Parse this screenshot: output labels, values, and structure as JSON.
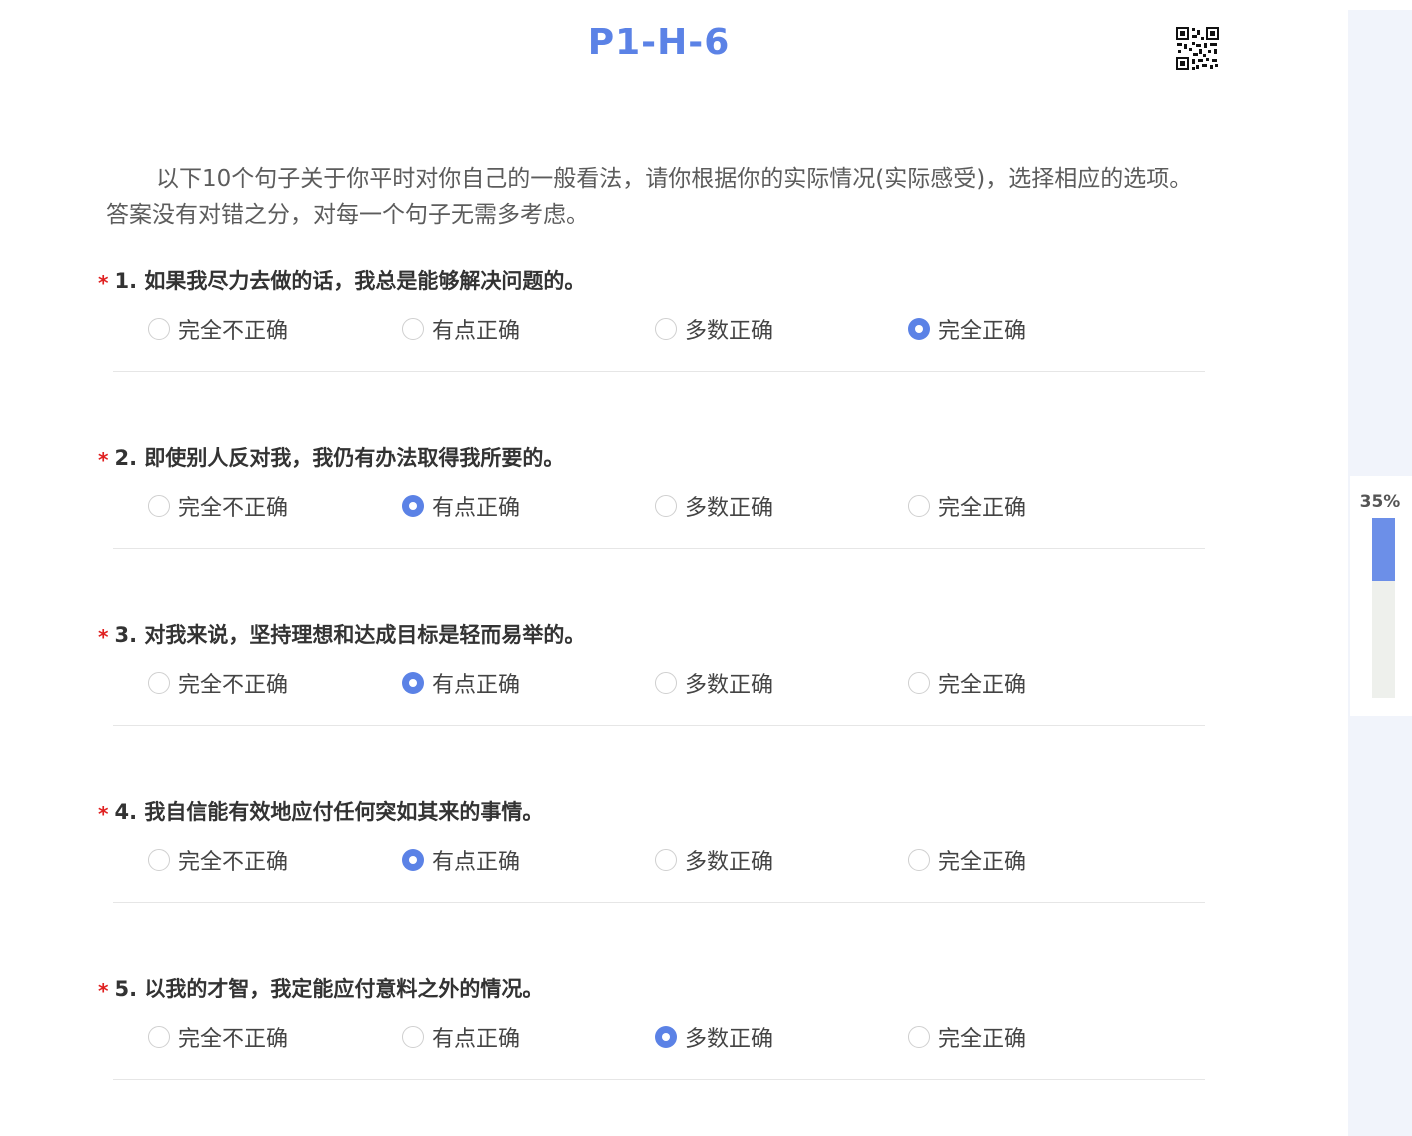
{
  "header": {
    "title": "P1-H-6",
    "qr_icon": "qr-code-icon"
  },
  "intro": "以下10个句子关于你平时对你自己的一般看法，请你根据你的实际情况(实际感受)，选择相应的选项。答案没有对错之分，对每一个句子无需多考虑。",
  "required_mark": "*",
  "options": [
    "完全不正确",
    "有点正确",
    "多数正确",
    "完全正确"
  ],
  "questions": [
    {
      "title": "1. 如果我尽力去做的话，我总是能够解决问题的。",
      "selected_index": 3
    },
    {
      "title": "2. 即使别人反对我，我仍有办法取得我所要的。",
      "selected_index": 1
    },
    {
      "title": "3. 对我来说，坚持理想和达成目标是轻而易举的。",
      "selected_index": 1
    },
    {
      "title": "4. 我自信能有效地应付任何突如其来的事情。",
      "selected_index": 1
    },
    {
      "title": "5. 以我的才智，我定能应付意料之外的情况。",
      "selected_index": 2
    }
  ],
  "progress": {
    "label": "35%",
    "value": 0.35
  },
  "colors": {
    "accent": "#5b82e6",
    "required": "#e02020",
    "progress_fill": "#6c8fe8",
    "progress_track": "#eef0ec",
    "side_panel": "#f1f4fb"
  }
}
